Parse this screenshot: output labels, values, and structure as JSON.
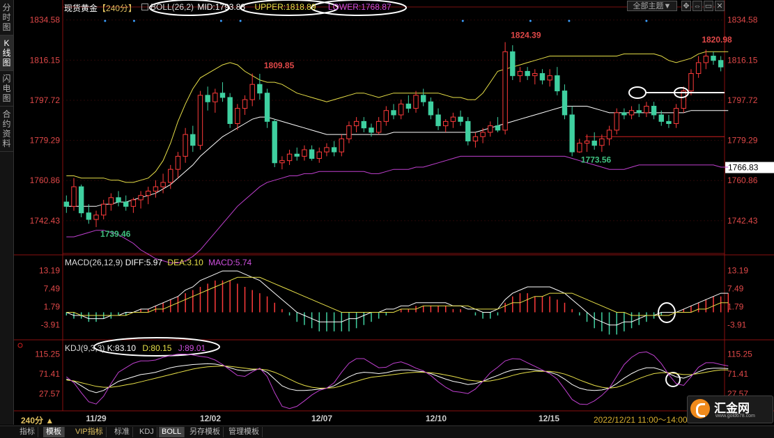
{
  "sidebar": {
    "tabs": [
      {
        "label": "分时图",
        "active": false
      },
      {
        "label": "K线图",
        "active": true
      },
      {
        "label": "闪电图",
        "active": false
      },
      {
        "label": "合约资料",
        "active": false
      }
    ]
  },
  "header": {
    "instrument": "现货黄金",
    "period": "【240分】",
    "boll_label": "BOLL(26,2)",
    "mid": "MID:1793.88",
    "upper": "UPPER:1818.89",
    "lower": "LOWER:1768.87",
    "theme_button": "全部主题▼"
  },
  "price_axis": {
    "ticks": [
      "1834.58",
      "1816.15",
      "1797.72",
      "1779.29",
      "1760.86",
      "1742.43"
    ],
    "current_price": "1766.83",
    "annotations": [
      {
        "text": "1824.39",
        "role": "high"
      },
      {
        "text": "1809.85",
        "role": "high"
      },
      {
        "text": "1820.98",
        "role": "high"
      },
      {
        "text": "1739.46",
        "role": "low"
      },
      {
        "text": "1773.56",
        "role": "low"
      }
    ]
  },
  "macd": {
    "label": "MACD(26,12,9)",
    "diff": "DIFF:5.97",
    "dea": "DEA:3.10",
    "macd": "MACD:5.74",
    "ticks": [
      "13.19",
      "7.49",
      "1.79",
      "-3.91"
    ]
  },
  "kdj": {
    "label": "KDJ(9,3,3)",
    "k": "K:83.10",
    "d": "D:80.15",
    "j": "J:89.01",
    "ticks": [
      "115.25",
      "71.41",
      "27.57"
    ]
  },
  "time_axis": {
    "period_label": "240分 ▲",
    "dates": [
      "11/29",
      "12/02",
      "12/07",
      "12/10",
      "12/15"
    ],
    "crosshair_time": "2022/12/21 11:00～14:00"
  },
  "bottom_tabs": [
    {
      "label": "指标",
      "active": false
    },
    {
      "label": "模板",
      "active": true
    },
    {
      "label": "VIP指标",
      "active": false,
      "color": "#e0c060"
    },
    {
      "label": "标准",
      "active": false
    },
    {
      "label": "KDJ",
      "active": false
    },
    {
      "label": "BOLL",
      "active": true
    },
    {
      "label": "另存模板",
      "active": false
    },
    {
      "label": "管理模板",
      "active": false
    }
  ],
  "watermark": {
    "name": "汇金网",
    "url": "www.gold678.com"
  },
  "colors": {
    "up": "#ff3b3b",
    "down": "#3fd0a0",
    "boll_mid": "#ffffff",
    "boll_upper": "#e8e048",
    "boll_lower": "#c040d0",
    "axis_text": "#e04848",
    "low_label": "#40c080"
  },
  "chart_data": {
    "type": "candlestick",
    "candles": [
      [
        1751,
        1754,
        1746,
        1749
      ],
      [
        1749,
        1762,
        1747,
        1758
      ],
      [
        1758,
        1759,
        1744,
        1746
      ],
      [
        1746,
        1750,
        1741,
        1743
      ],
      [
        1743,
        1747,
        1739.46,
        1745
      ],
      [
        1745,
        1752,
        1743,
        1750
      ],
      [
        1750,
        1755,
        1747,
        1753
      ],
      [
        1753,
        1756,
        1749,
        1751
      ],
      [
        1751,
        1754,
        1747,
        1749
      ],
      [
        1749,
        1753,
        1746,
        1752
      ],
      [
        1752,
        1756,
        1748,
        1754
      ],
      [
        1754,
        1758,
        1750,
        1756
      ],
      [
        1756,
        1761,
        1753,
        1758
      ],
      [
        1758,
        1764,
        1755,
        1760
      ],
      [
        1760,
        1768,
        1757,
        1766
      ],
      [
        1766,
        1774,
        1762,
        1772
      ],
      [
        1772,
        1785,
        1769,
        1782
      ],
      [
        1782,
        1786,
        1774,
        1777
      ],
      [
        1777,
        1802,
        1775,
        1800
      ],
      [
        1800,
        1804,
        1793,
        1797
      ],
      [
        1797,
        1803,
        1792,
        1801
      ],
      [
        1801,
        1806,
        1797,
        1799
      ],
      [
        1799,
        1801,
        1785,
        1787
      ],
      [
        1787,
        1796,
        1784,
        1794
      ],
      [
        1794,
        1800,
        1791,
        1798
      ],
      [
        1798,
        1810,
        1795,
        1805
      ],
      [
        1805,
        1809.85,
        1798,
        1801
      ],
      [
        1801,
        1803,
        1785,
        1788
      ],
      [
        1788,
        1789,
        1767,
        1769
      ],
      [
        1769,
        1772,
        1766,
        1770
      ],
      [
        1770,
        1775,
        1768,
        1773
      ],
      [
        1773,
        1776,
        1770,
        1772
      ],
      [
        1772,
        1777,
        1770,
        1775
      ],
      [
        1775,
        1777,
        1770,
        1771
      ],
      [
        1771,
        1776,
        1769,
        1774
      ],
      [
        1774,
        1778,
        1772,
        1776
      ],
      [
        1776,
        1779,
        1772,
        1774
      ],
      [
        1774,
        1782,
        1772,
        1780
      ],
      [
        1780,
        1788,
        1778,
        1786
      ],
      [
        1786,
        1790,
        1783,
        1788
      ],
      [
        1788,
        1790,
        1783,
        1785
      ],
      [
        1785,
        1787,
        1781,
        1783
      ],
      [
        1783,
        1790,
        1782,
        1788
      ],
      [
        1788,
        1795,
        1786,
        1793
      ],
      [
        1793,
        1796,
        1789,
        1791
      ],
      [
        1791,
        1798,
        1789,
        1796
      ],
      [
        1796,
        1800,
        1792,
        1794
      ],
      [
        1794,
        1802,
        1792,
        1800
      ],
      [
        1800,
        1803,
        1795,
        1797
      ],
      [
        1797,
        1799,
        1789,
        1791
      ],
      [
        1791,
        1794,
        1784,
        1786
      ],
      [
        1786,
        1789,
        1783,
        1788
      ],
      [
        1788,
        1792,
        1785,
        1790
      ],
      [
        1790,
        1793,
        1786,
        1788
      ],
      [
        1788,
        1790,
        1777,
        1779
      ],
      [
        1779,
        1783,
        1776,
        1781
      ],
      [
        1781,
        1785,
        1778,
        1783
      ],
      [
        1783,
        1788,
        1781,
        1786
      ],
      [
        1786,
        1790,
        1783,
        1784
      ],
      [
        1784,
        1824.39,
        1782,
        1820
      ],
      [
        1820,
        1823,
        1807,
        1809
      ],
      [
        1809,
        1813,
        1806,
        1811
      ],
      [
        1811,
        1813,
        1807,
        1809
      ],
      [
        1809,
        1812,
        1805,
        1810
      ],
      [
        1810,
        1812,
        1805,
        1807
      ],
      [
        1807,
        1812,
        1804,
        1809
      ],
      [
        1809,
        1813,
        1800,
        1802
      ],
      [
        1802,
        1805,
        1789,
        1791
      ],
      [
        1791,
        1795,
        1772,
        1774
      ],
      [
        1774,
        1780,
        1773.56,
        1778
      ],
      [
        1778,
        1782,
        1774,
        1779
      ],
      [
        1779,
        1783,
        1775,
        1777
      ],
      [
        1777,
        1782,
        1774,
        1780
      ],
      [
        1780,
        1786,
        1777,
        1784
      ],
      [
        1784,
        1794,
        1782,
        1792
      ],
      [
        1792,
        1794,
        1789,
        1791
      ],
      [
        1791,
        1795,
        1789,
        1793
      ],
      [
        1793,
        1796,
        1790,
        1792
      ],
      [
        1792,
        1797,
        1790,
        1795
      ],
      [
        1795,
        1797,
        1789,
        1791
      ],
      [
        1791,
        1793,
        1786,
        1788
      ],
      [
        1788,
        1791,
        1785,
        1787
      ],
      [
        1787,
        1796,
        1785,
        1794
      ],
      [
        1794,
        1804,
        1792,
        1802
      ],
      [
        1802,
        1812,
        1800,
        1810
      ],
      [
        1810,
        1818,
        1808,
        1815
      ],
      [
        1815,
        1820.98,
        1812,
        1818
      ],
      [
        1818,
        1820,
        1814,
        1816
      ],
      [
        1816,
        1818,
        1811,
        1813
      ]
    ],
    "boll_upper": [
      1763,
      1763,
      1762,
      1762,
      1762,
      1762,
      1761,
      1761,
      1760,
      1760,
      1761,
      1762,
      1765,
      1770,
      1778,
      1788,
      1796,
      1803,
      1808,
      1810,
      1812,
      1814,
      1815,
      1814,
      1811,
      1809,
      1807,
      1806,
      1806,
      1805,
      1803,
      1801,
      1800,
      1799,
      1798,
      1797,
      1798,
      1799,
      1800,
      1801,
      1801,
      1800,
      1799,
      1800,
      1801,
      1801,
      1801,
      1801,
      1801,
      1801,
      1801,
      1800,
      1799,
      1799,
      1798,
      1798,
      1801,
      1806,
      1811,
      1812,
      1813,
      1814,
      1815,
      1816,
      1817,
      1818,
      1818,
      1818,
      1818,
      1818,
      1818,
      1818,
      1818,
      1818,
      1818,
      1819,
      1819,
      1819,
      1819,
      1819,
      1818,
      1816,
      1815,
      1816,
      1817,
      1819,
      1820,
      1820,
      1820,
      1820
    ],
    "boll_mid": [
      1749,
      1749,
      1749,
      1749,
      1749,
      1750,
      1750,
      1751,
      1751,
      1752,
      1753,
      1754,
      1755,
      1757,
      1759,
      1762,
      1765,
      1768,
      1772,
      1775,
      1778,
      1781,
      1783,
      1785,
      1787,
      1789,
      1790,
      1790,
      1789,
      1788,
      1787,
      1786,
      1785,
      1784,
      1783,
      1782,
      1782,
      1782,
      1782,
      1782,
      1782,
      1782,
      1782,
      1782,
      1783,
      1783,
      1783,
      1783,
      1783,
      1783,
      1783,
      1783,
      1783,
      1783,
      1783,
      1783,
      1784,
      1785,
      1786,
      1787,
      1788,
      1789,
      1790,
      1791,
      1792,
      1793,
      1794,
      1795,
      1795,
      1795,
      1795,
      1794,
      1793,
      1792,
      1792,
      1792,
      1792,
      1792,
      1792,
      1792,
      1792,
      1792,
      1792,
      1792,
      1793,
      1793,
      1793,
      1793,
      1793,
      1793
    ],
    "boll_lower": [
      1735,
      1735,
      1736,
      1737,
      1738,
      1738,
      1737,
      1736,
      1734,
      1732,
      1729,
      1727,
      1725,
      1724,
      1723,
      1723,
      1724,
      1726,
      1729,
      1733,
      1737,
      1741,
      1745,
      1749,
      1752,
      1755,
      1758,
      1760,
      1761,
      1762,
      1763,
      1763,
      1764,
      1764,
      1765,
      1765,
      1765,
      1765,
      1765,
      1765,
      1765,
      1764,
      1764,
      1765,
      1766,
      1766,
      1766,
      1767,
      1767,
      1768,
      1769,
      1770,
      1771,
      1772,
      1772,
      1772,
      1772,
      1772,
      1772,
      1772,
      1772,
      1772,
      1772,
      1772,
      1772,
      1772,
      1772,
      1772,
      1771,
      1770,
      1769,
      1768,
      1767,
      1766,
      1766,
      1766,
      1767,
      1768,
      1768,
      1768,
      1768,
      1768,
      1768,
      1768,
      1768,
      1768,
      1768,
      1768,
      1767,
      1767
    ],
    "macd_hist": [
      -1,
      -2,
      -2,
      -3,
      -3,
      -2,
      -2,
      -1,
      -1,
      0,
      1,
      1,
      2,
      3,
      4,
      5,
      6,
      7,
      8,
      9,
      10,
      10,
      10,
      9,
      8,
      7,
      6,
      5,
      3,
      1,
      -1,
      -3,
      -4,
      -5,
      -6,
      -6,
      -6,
      -6,
      -6,
      -5,
      -4,
      -3,
      -2,
      -1,
      0,
      1,
      1,
      2,
      2,
      2,
      2,
      2,
      1,
      1,
      0,
      -1,
      -2,
      -2,
      -1,
      3,
      5,
      6,
      6,
      5,
      5,
      5,
      4,
      3,
      1,
      -1,
      -3,
      -5,
      -6,
      -7,
      -7,
      -6,
      -5,
      -4,
      -3,
      -2,
      -1,
      0,
      0,
      1,
      2,
      3,
      4,
      5,
      5,
      6
    ],
    "macd_diff": [
      0,
      -1,
      -1,
      -2,
      -2,
      -2,
      -1,
      -1,
      0,
      0,
      1,
      1,
      2,
      3,
      4,
      5,
      7,
      8,
      10,
      11,
      12,
      13,
      13,
      13,
      12,
      11,
      10,
      8,
      6,
      4,
      2,
      0,
      -1,
      -2,
      -3,
      -3,
      -3,
      -3,
      -2,
      -2,
      -1,
      0,
      0,
      1,
      1,
      2,
      2,
      3,
      3,
      3,
      3,
      3,
      2,
      2,
      1,
      1,
      0,
      0,
      1,
      4,
      6,
      7,
      8,
      8,
      8,
      8,
      7,
      6,
      4,
      2,
      0,
      -2,
      -3,
      -4,
      -4,
      -3,
      -3,
      -2,
      -1,
      -1,
      0,
      0,
      0,
      1,
      2,
      3,
      4,
      5,
      6,
      6
    ],
    "macd_dea": [
      0,
      0,
      -1,
      -1,
      -1,
      -1,
      -1,
      -1,
      -1,
      0,
      0,
      0,
      1,
      1,
      2,
      3,
      4,
      5,
      6,
      7,
      8,
      9,
      10,
      11,
      11,
      11,
      11,
      10,
      9,
      8,
      7,
      6,
      5,
      4,
      3,
      2,
      1,
      0,
      0,
      0,
      0,
      0,
      0,
      0,
      0,
      1,
      1,
      1,
      2,
      2,
      2,
      2,
      2,
      2,
      2,
      1,
      1,
      1,
      1,
      2,
      3,
      3,
      4,
      5,
      5,
      6,
      6,
      6,
      6,
      5,
      4,
      3,
      2,
      1,
      0,
      0,
      -1,
      -1,
      -1,
      -1,
      -1,
      -1,
      0,
      0,
      0,
      1,
      1,
      2,
      3,
      3
    ],
    "kdj_k": [
      60,
      55,
      45,
      35,
      30,
      35,
      45,
      55,
      60,
      65,
      70,
      72,
      75,
      80,
      85,
      88,
      90,
      92,
      93,
      94,
      93,
      90,
      85,
      80,
      78,
      80,
      82,
      75,
      60,
      45,
      38,
      35,
      35,
      36,
      38,
      40,
      45,
      55,
      65,
      72,
      75,
      74,
      72,
      74,
      78,
      80,
      80,
      78,
      76,
      72,
      66,
      60,
      55,
      52,
      48,
      50,
      55,
      62,
      68,
      75,
      80,
      82,
      82,
      80,
      78,
      75,
      70,
      60,
      48,
      40,
      36,
      35,
      36,
      40,
      50,
      62,
      72,
      80,
      85,
      85,
      80,
      72,
      65,
      62,
      68,
      76,
      82,
      84,
      84,
      83
    ],
    "kdj_d": [
      58,
      56,
      52,
      48,
      44,
      42,
      42,
      44,
      47,
      50,
      54,
      58,
      62,
      66,
      70,
      74,
      78,
      82,
      85,
      87,
      88,
      89,
      88,
      86,
      84,
      82,
      82,
      80,
      75,
      68,
      60,
      52,
      46,
      42,
      40,
      40,
      41,
      45,
      50,
      55,
      60,
      64,
      66,
      68,
      70,
      72,
      74,
      75,
      75,
      74,
      72,
      69,
      66,
      62,
      58,
      56,
      55,
      56,
      59,
      63,
      68,
      72,
      75,
      77,
      77,
      77,
      75,
      71,
      65,
      58,
      52,
      46,
      42,
      40,
      42,
      47,
      54,
      61,
      67,
      72,
      74,
      74,
      72,
      70,
      70,
      72,
      75,
      78,
      80,
      80
    ],
    "kdj_j": [
      65,
      52,
      30,
      10,
      5,
      22,
      50,
      75,
      85,
      95,
      100,
      100,
      102,
      108,
      112,
      115,
      115,
      113,
      110,
      108,
      102,
      92,
      80,
      68,
      66,
      76,
      84,
      66,
      30,
      0,
      -5,
      0,
      12,
      25,
      35,
      40,
      52,
      75,
      95,
      105,
      105,
      95,
      85,
      86,
      95,
      98,
      92,
      84,
      78,
      68,
      54,
      42,
      33,
      31,
      28,
      38,
      55,
      74,
      86,
      100,
      105,
      104,
      96,
      88,
      80,
      72,
      60,
      38,
      15,
      5,
      4,
      12,
      24,
      40,
      66,
      92,
      108,
      118,
      120,
      112,
      94,
      70,
      50,
      46,
      65,
      86,
      96,
      96,
      92,
      89
    ]
  }
}
